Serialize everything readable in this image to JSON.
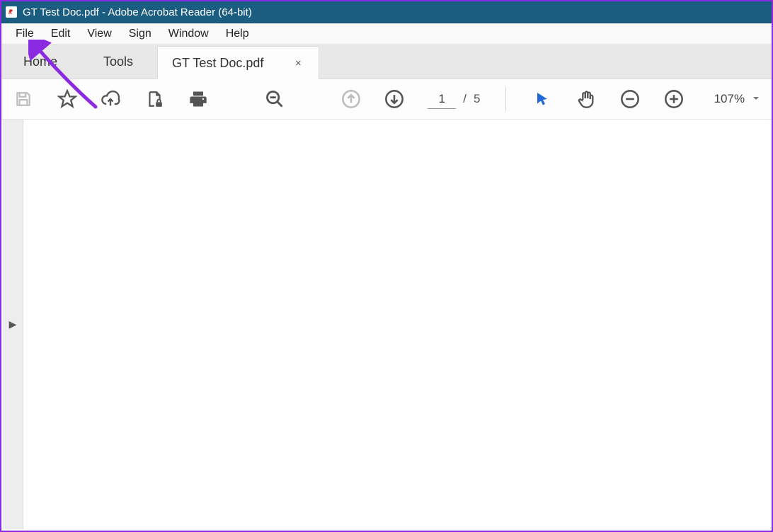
{
  "window": {
    "title": "GT Test Doc.pdf - Adobe Acrobat Reader (64-bit)"
  },
  "menubar": {
    "items": [
      "File",
      "Edit",
      "View",
      "Sign",
      "Window",
      "Help"
    ]
  },
  "tabs": {
    "home": "Home",
    "tools": "Tools",
    "doc_label": "GT Test Doc.pdf",
    "close_glyph": "×"
  },
  "toolbar": {
    "page_current": "1",
    "page_total_prefix": "/",
    "page_total": "5",
    "zoom_value": "107%"
  },
  "nav": {
    "expand_glyph": "▶"
  },
  "annotation": {
    "color": "#8a2be2"
  }
}
